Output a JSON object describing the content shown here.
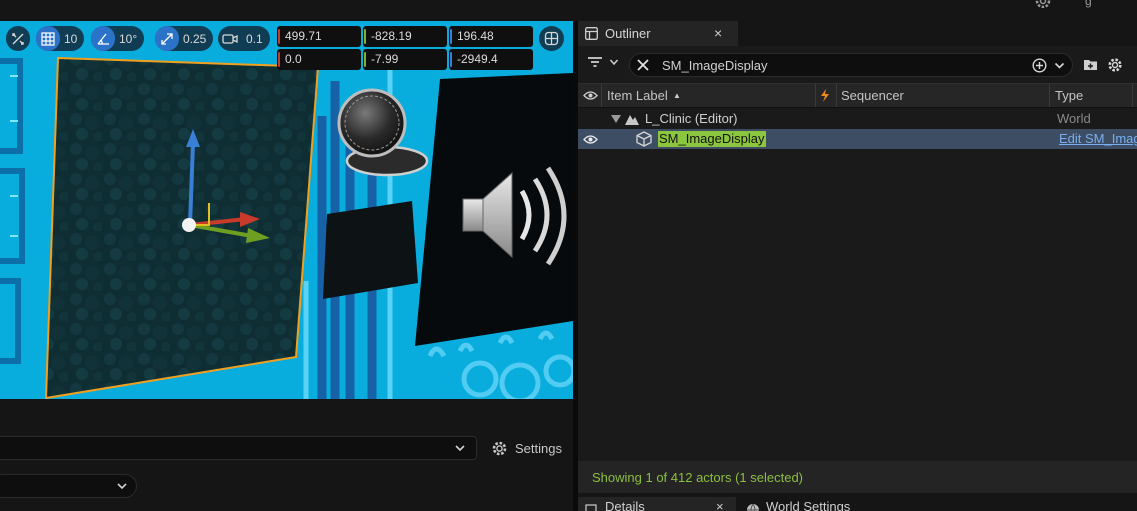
{
  "window": {
    "top_right_text": "g"
  },
  "viewport": {
    "toolbar": {
      "grid_snap_value": "10",
      "rotation_snap_value": "10°",
      "scale_snap_value": "0.25",
      "camera_speed_value": "0.1"
    },
    "transform": {
      "location": [
        "499.71",
        "-828.19",
        "196.48"
      ],
      "rotation": [
        "0.0",
        "-7.99",
        "-2949.4"
      ]
    }
  },
  "bottom_toolbar": {
    "settings_label": "Settings"
  },
  "outliner": {
    "tab_title": "Outliner",
    "tab_close": "×",
    "search_value": "SM_ImageDisplay",
    "columns": {
      "item_label": "Item Label",
      "sort_indicator": "▲",
      "sequencer": "Sequencer",
      "type": "Type"
    },
    "rows": [
      {
        "label": "L_Clinic (Editor)",
        "type": "World"
      },
      {
        "label": "SM_ImageDisplay",
        "type": "Edit SM_Imag"
      }
    ],
    "footer_status": "Showing 1 of 412 actors (1 selected)"
  },
  "bottom_tabs": {
    "details": "Details",
    "world_settings": "World Settings"
  },
  "colors": {
    "accent_blue": "#2b73c9",
    "selection_row": "#3d4e64",
    "search_highlight": "#8cc63f",
    "status_green": "#8cbf3f",
    "axis_x": "#c83a2a",
    "axis_y": "#7fb32b",
    "axis_z": "#3a7fd6",
    "selection_outline": "#f0a020"
  }
}
